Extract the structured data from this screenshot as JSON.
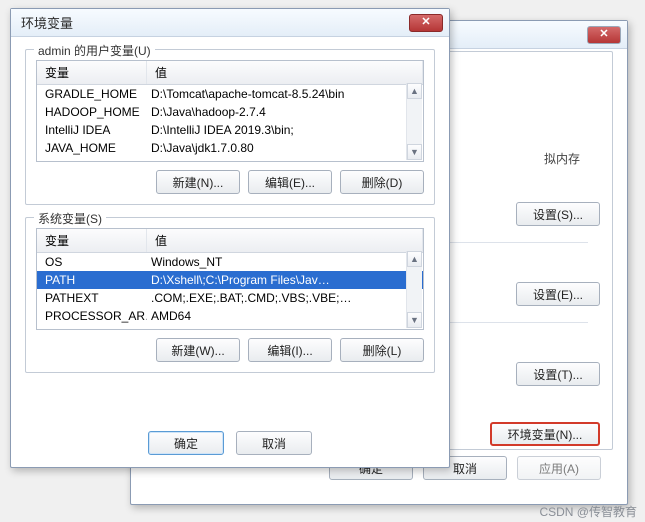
{
  "front": {
    "title": "环境变量",
    "close": "✕",
    "user_group": {
      "legend": "admin 的用户变量(U)",
      "col_name": "变量",
      "col_value": "值",
      "rows": [
        {
          "name": "GRADLE_HOME",
          "value": "D:\\Tomcat\\apache-tomcat-8.5.24\\bin"
        },
        {
          "name": "HADOOP_HOME",
          "value": "D:\\Java\\hadoop-2.7.4"
        },
        {
          "name": "IntelliJ IDEA",
          "value": "D:\\IntelliJ IDEA 2019.3\\bin;"
        },
        {
          "name": "JAVA_HOME",
          "value": "D:\\Java\\jdk1.7.0.80"
        }
      ],
      "btn_new": "新建(N)...",
      "btn_edit": "编辑(E)...",
      "btn_delete": "删除(D)"
    },
    "sys_group": {
      "legend": "系统变量(S)",
      "col_name": "变量",
      "col_value": "值",
      "rows": [
        {
          "name": "OS",
          "value": "Windows_NT"
        },
        {
          "name": "PATH",
          "value": "D:\\Xshell\\;C:\\Program Files\\Jav…",
          "selected": true
        },
        {
          "name": "PATHEXT",
          "value": ".COM;.EXE;.BAT;.CMD;.VBS;.VBE;…"
        },
        {
          "name": "PROCESSOR_AR…",
          "value": "AMD64"
        }
      ],
      "btn_new": "新建(W)...",
      "btn_edit": "编辑(I)...",
      "btn_delete": "删除(L)"
    },
    "ok": "确定",
    "cancel": "取消"
  },
  "back": {
    "close": "✕",
    "line1": "拟内存",
    "btn_set_s": "设置(S)...",
    "btn_set_e": "设置(E)...",
    "btn_set_t": "设置(T)...",
    "btn_env": "环境变量(N)...",
    "ok": "确定",
    "cancel": "取消",
    "apply": "应用(A)"
  },
  "watermark": "CSDN @传智教育"
}
